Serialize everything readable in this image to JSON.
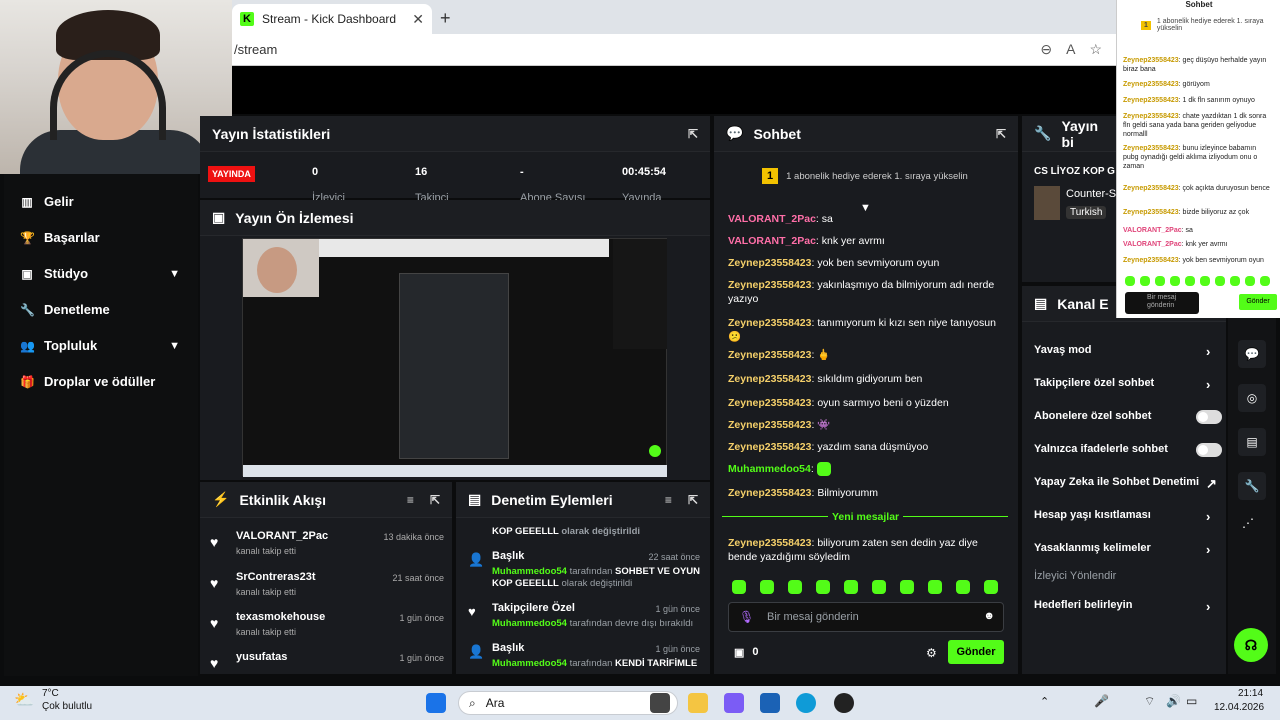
{
  "browser": {
    "tab_title": "Stream - Kick Dashboard",
    "tab_close": "✕",
    "new_tab": "+",
    "address": "/stream"
  },
  "sidebar": {
    "items": [
      {
        "label": "Gelir",
        "icon": "chart-icon"
      },
      {
        "label": "Başarılar",
        "icon": "trophy-icon"
      },
      {
        "label": "Stüdyo",
        "icon": "studio-icon",
        "expandable": true
      },
      {
        "label": "Denetleme",
        "icon": "wrench-icon"
      },
      {
        "label": "Topluluk",
        "icon": "community-icon",
        "expandable": true
      },
      {
        "label": "Droplar ve ödüller",
        "icon": "gift-icon"
      }
    ]
  },
  "stats": {
    "title": "Yayın İstatistikleri",
    "live_badge": "YAYINDA",
    "viewers_value": "0",
    "viewers_label": "İzleyici",
    "followers_value": "16",
    "followers_label": "Takipçi",
    "subs_value": "-",
    "subs_label": "Abone Sayısı",
    "duration_value": "00:45:54",
    "duration_label": "Yayında"
  },
  "preview": {
    "title": "Yayın Ön İzlemesi"
  },
  "activity": {
    "title": "Etkinlik Akışı",
    "items": [
      {
        "name": "VALORANT_2Pac",
        "sub": "kanalı takip etti",
        "time": "13 dakika önce"
      },
      {
        "name": "SrContreras23t",
        "sub": "kanalı takip etti",
        "time": "21 saat önce"
      },
      {
        "name": "texasmokehouse",
        "sub": "kanalı takip etti",
        "time": "1 gün önce"
      },
      {
        "name": "yusufatas",
        "sub": "",
        "time": "1 gün önce"
      }
    ]
  },
  "modlog": {
    "title": "Denetim Eylemleri",
    "top_line_a": "KOP GEEELLL",
    "top_line_b": "olarak değiştirildi",
    "items": [
      {
        "title": "Başlık",
        "time": "22 saat önce",
        "user": "Muhammedoo54",
        "mid": "tarafından",
        "bold": "SOHBET VE OYUN",
        "line2a": "KOP GEEELLL",
        "line2b": "olarak değiştirildi"
      },
      {
        "title": "Takipçilere Özel",
        "time": "1 gün önce",
        "user": "Muhammedoo54",
        "mid": "tarafından devre dışı bırakıldı"
      },
      {
        "title": "Başlık",
        "time": "1 gün önce",
        "user": "Muhammedoo54",
        "mid": "tarafından",
        "bold": "KENDİ TARİFİMLE"
      }
    ]
  },
  "chat": {
    "title": "Sohbet",
    "pinned": "1 abonelik hediye ederek 1. sıraya yükselin",
    "messages": [
      {
        "user": "VALORANT_2Pac",
        "text": "sa",
        "color": "pink"
      },
      {
        "user": "VALORANT_2Pac",
        "text": "knk yer avrmı",
        "color": "pink"
      },
      {
        "user": "Zeynep23558423",
        "text": "yok ben sevmiyorum oyun",
        "color": "yel"
      },
      {
        "user": "Zeynep23558423",
        "text": "yakınlaşmıyo da bilmiyorum adı nerde yazıyo",
        "color": "yel"
      },
      {
        "user": "Zeynep23558423",
        "text": "tanımıyorum ki kızı sen niye tanıyosun 😕",
        "color": "yel"
      },
      {
        "user": "Zeynep23558423",
        "text": "🖕",
        "color": "yel"
      },
      {
        "user": "Zeynep23558423",
        "text": "sıkıldım gidiyorum ben",
        "color": "yel"
      },
      {
        "user": "Zeynep23558423",
        "text": "oyun sarmıyo beni o yüzden",
        "color": "yel"
      },
      {
        "user": "Zeynep23558423",
        "text": "👾",
        "color": "yel"
      },
      {
        "user": "Zeynep23558423",
        "text": "yazdım sana düşmüyoo",
        "color": "yel"
      },
      {
        "user": "Muhammedoo54",
        "text": "",
        "color": "green"
      },
      {
        "user": "Zeynep23558423",
        "text": "Bilmiyorumm",
        "color": "yel"
      }
    ],
    "new_messages": "Yeni mesajlar",
    "after_new": {
      "user": "Zeynep23558423",
      "text": "biliyorum zaten sen dedin yaz diye bende yazdığımı söyledim"
    },
    "input_placeholder": "Bir mesaj gönderin",
    "points": "0",
    "send": "Gönder"
  },
  "stream_info": {
    "title": "Yayın bi",
    "stream_title": "CS LİYOZ KOP G",
    "category": "Counter-S",
    "language": "Turkish"
  },
  "channel": {
    "title": "Kanal E",
    "items": [
      {
        "label": "Yavaş mod",
        "type": "arrow"
      },
      {
        "label": "Takipçilere özel sohbet",
        "type": "arrow"
      },
      {
        "label": "Abonelere özel sohbet",
        "type": "toggle"
      },
      {
        "label": "Yalnızca ifadelerle sohbet",
        "type": "toggle"
      },
      {
        "label": "Yapay Zeka ile Sohbet Denetimi",
        "type": "ext"
      },
      {
        "label": "Hesap yaşı kısıtlaması",
        "type": "arrow"
      },
      {
        "label": "Yasaklanmış kelimeler",
        "type": "arrow"
      },
      {
        "label": "İzleyici Yönlendir",
        "type": "none"
      },
      {
        "label": "Hedefleri belirleyin",
        "type": "arrow"
      }
    ]
  },
  "popout": {
    "header": "Sohbet",
    "pinned": "1 abonelik hediye ederek 1. sıraya yükselin",
    "lines": [
      {
        "user": "Zeynep23558423",
        "text": "geç düşüyo herhalde yayın biraz bana"
      },
      {
        "user": "Zeynep23558423",
        "text": "görüyom"
      },
      {
        "user": "Zeynep23558423",
        "text": "1 dk fln sanırım oynuyo"
      },
      {
        "user": "Zeynep23558423",
        "text": "chate yazdıktan 1 dk sonra fln geldi sana yada bana geriden geliyodue normalll"
      },
      {
        "user": "Zeynep23558423",
        "text": "bunu izleyince babamın pubg oynadığı geldi aklıma izliyodum onu o zaman"
      },
      {
        "user": "Zeynep23558423",
        "text": "çok açıkta duruyosun bence"
      },
      {
        "user": "Zeynep23558423",
        "text": "bizde biliyoruz az çok"
      },
      {
        "user": "VALORANT_2Pac",
        "text": "sa"
      },
      {
        "user": "VALORANT_2Pac",
        "text": "knk yer avrmı"
      },
      {
        "user": "Zeynep23558423",
        "text": "yok ben sevmiyorum oyun"
      }
    ],
    "input": "Bir mesaj gönderin",
    "send": "Gönder"
  },
  "taskbar": {
    "temp": "7°C",
    "weather": "Çok bulutlu",
    "search": "Ara",
    "time": "21:14",
    "date": "12.04.2026"
  }
}
